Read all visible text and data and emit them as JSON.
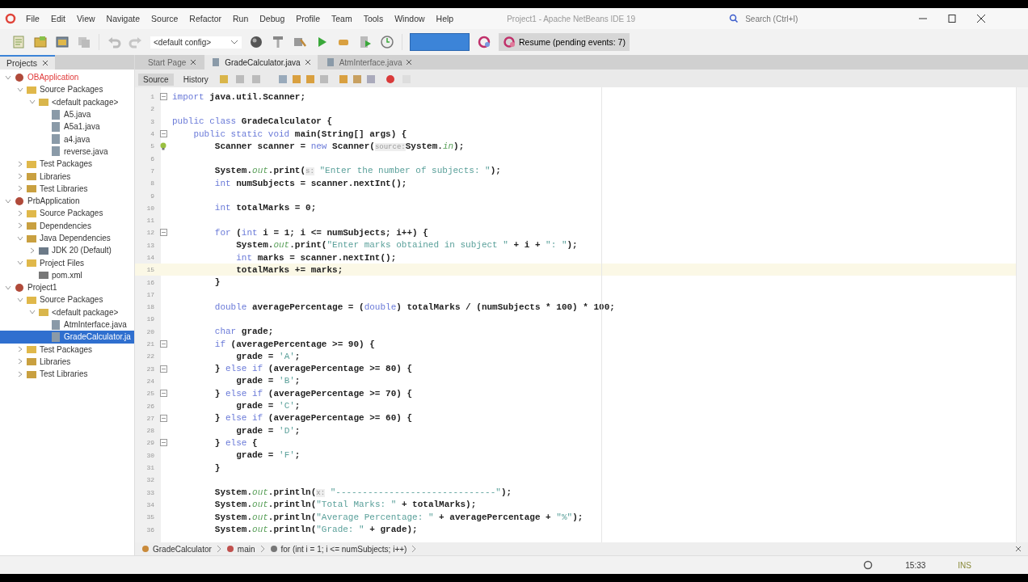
{
  "window": {
    "title": "Project1 - Apache NetBeans IDE 19",
    "search": {
      "placeholder": "Search (Ctrl+I)"
    }
  },
  "menu": [
    "File",
    "Edit",
    "View",
    "Navigate",
    "Source",
    "Refactor",
    "Run",
    "Debug",
    "Profile",
    "Team",
    "Tools",
    "Window",
    "Help"
  ],
  "toolbar": {
    "config": "<default config>",
    "resume": "Resume (pending events: 7)"
  },
  "side_tabs": [
    {
      "label": "Projects",
      "selected": true
    }
  ],
  "tree": [
    {
      "label": "OBApplication",
      "kind": "project",
      "error": true,
      "expanded": true,
      "selected": false,
      "children": [
        {
          "label": "Source Packages",
          "kind": "folder",
          "expanded": true,
          "selected": false,
          "children": [
            {
              "label": "<default package>",
              "kind": "package",
              "expanded": true,
              "selected": false,
              "children": [
                {
                  "label": "A5.java",
                  "kind": "java",
                  "selected": false
                },
                {
                  "label": "A5a1.java",
                  "kind": "java",
                  "selected": false
                },
                {
                  "label": "a4.java",
                  "kind": "java",
                  "selected": false
                },
                {
                  "label": "reverse.java",
                  "kind": "java",
                  "selected": false
                }
              ]
            }
          ]
        },
        {
          "label": "Test Packages",
          "kind": "folder",
          "expanded": false,
          "selected": false
        },
        {
          "label": "Libraries",
          "kind": "library",
          "expanded": false,
          "selected": false
        },
        {
          "label": "Test Libraries",
          "kind": "library",
          "expanded": false,
          "selected": false
        }
      ]
    },
    {
      "label": "PrbApplication",
      "kind": "project",
      "error": false,
      "expanded": true,
      "selected": false,
      "children": [
        {
          "label": "Source Packages",
          "kind": "folder",
          "expanded": false,
          "selected": false
        },
        {
          "label": "Dependencies",
          "kind": "library",
          "expanded": false,
          "selected": false
        },
        {
          "label": "Java Dependencies",
          "kind": "library",
          "expanded": true,
          "selected": false,
          "children": [
            {
              "label": "JDK 20 (Default)",
              "kind": "jdk",
              "expanded": false,
              "selected": false
            }
          ]
        },
        {
          "label": "Project Files",
          "kind": "folder",
          "expanded": true,
          "selected": false,
          "children": [
            {
              "label": "pom.xml",
              "kind": "xml",
              "selected": false
            }
          ]
        }
      ]
    },
    {
      "label": "Project1",
      "kind": "project",
      "error": false,
      "expanded": true,
      "selected": false,
      "children": [
        {
          "label": "Source Packages",
          "kind": "folder",
          "expanded": true,
          "selected": false,
          "children": [
            {
              "label": "<default package>",
              "kind": "package",
              "expanded": true,
              "selected": false,
              "children": [
                {
                  "label": "AtmInterface.java",
                  "kind": "java",
                  "selected": false
                },
                {
                  "label": "GradeCalculator.ja",
                  "kind": "java",
                  "selected": true
                }
              ]
            }
          ]
        },
        {
          "label": "Test Packages",
          "kind": "folder",
          "expanded": false,
          "selected": false
        },
        {
          "label": "Libraries",
          "kind": "library",
          "expanded": false,
          "selected": false
        },
        {
          "label": "Test Libraries",
          "kind": "library",
          "expanded": false,
          "selected": false
        }
      ]
    }
  ],
  "editor_tabs": [
    {
      "label": "Start Page",
      "selected": false
    },
    {
      "label": "GradeCalculator.java",
      "selected": true
    },
    {
      "label": "AtmInterface.java",
      "selected": false
    }
  ],
  "view_tabs": [
    {
      "label": "Source",
      "selected": true
    },
    {
      "label": "History",
      "selected": false
    }
  ],
  "code": [
    {
      "n": "1",
      "current": false,
      "fold": true,
      "seg": [
        {
          "kind": "kw",
          "text": "import"
        },
        {
          "kind": "txt",
          "text": " java.util.Scanner;"
        }
      ]
    },
    {
      "n": "2",
      "current": false
    },
    {
      "n": "3",
      "current": false,
      "seg": [
        {
          "kind": "kw",
          "text": "public class"
        },
        {
          "kind": "txt",
          "text": " GradeCalculator {"
        }
      ]
    },
    {
      "n": "4",
      "current": false,
      "fold": true,
      "seg": [
        {
          "kind": "kw",
          "text": "    public static void"
        },
        {
          "kind": "txt",
          "text": " main(String[] args) {"
        }
      ]
    },
    {
      "n": "5",
      "current": false,
      "bulb": true,
      "seg": [
        {
          "kind": "txt",
          "text": "        Scanner scanner = "
        },
        {
          "kind": "kw",
          "text": "new"
        },
        {
          "kind": "txt",
          "text": " Scanner("
        },
        {
          "kind": "hint",
          "text": "source:"
        },
        {
          "kind": "txt",
          "text": "System."
        },
        {
          "kind": "field",
          "text": "in"
        },
        {
          "kind": "txt",
          "text": ");"
        }
      ]
    },
    {
      "n": "6",
      "current": false
    },
    {
      "n": "7",
      "current": false,
      "seg": [
        {
          "kind": "txt",
          "text": "        System."
        },
        {
          "kind": "field",
          "text": "out"
        },
        {
          "kind": "txt",
          "text": ".print("
        },
        {
          "kind": "hint",
          "text": "s:"
        },
        {
          "kind": "str",
          "text": " \"Enter the number of subjects: \""
        },
        {
          "kind": "txt",
          "text": ");"
        }
      ]
    },
    {
      "n": "8",
      "current": false,
      "seg": [
        {
          "kind": "kw",
          "text": "        int"
        },
        {
          "kind": "txt",
          "text": " numSubjects = scanner.nextInt();"
        }
      ]
    },
    {
      "n": "9",
      "current": false
    },
    {
      "n": "10",
      "current": false,
      "seg": [
        {
          "kind": "kw",
          "text": "        int"
        },
        {
          "kind": "txt",
          "text": " totalMarks = 0;"
        }
      ]
    },
    {
      "n": "11",
      "current": false
    },
    {
      "n": "12",
      "current": false,
      "fold": true,
      "seg": [
        {
          "kind": "kw",
          "text": "        for"
        },
        {
          "kind": "txt",
          "text": " ("
        },
        {
          "kind": "kw",
          "text": "int"
        },
        {
          "kind": "txt",
          "text": " i = 1; i <= numSubjects; i++) {"
        }
      ]
    },
    {
      "n": "13",
      "current": false,
      "seg": [
        {
          "kind": "txt",
          "text": "            System."
        },
        {
          "kind": "field",
          "text": "out"
        },
        {
          "kind": "txt",
          "text": ".print("
        },
        {
          "kind": "str",
          "text": "\"Enter marks obtained in subject \""
        },
        {
          "kind": "txt",
          "text": " + i + "
        },
        {
          "kind": "str",
          "text": "\": \""
        },
        {
          "kind": "txt",
          "text": ");"
        }
      ]
    },
    {
      "n": "14",
      "current": false,
      "seg": [
        {
          "kind": "kw",
          "text": "            int"
        },
        {
          "kind": "txt",
          "text": " marks = scanner.nextInt();"
        }
      ]
    },
    {
      "n": "15",
      "current": true,
      "seg": [
        {
          "kind": "txt",
          "text": "            totalMarks += marks;"
        }
      ]
    },
    {
      "n": "16",
      "current": false,
      "seg": [
        {
          "kind": "txt",
          "text": "        }"
        }
      ]
    },
    {
      "n": "17",
      "current": false
    },
    {
      "n": "18",
      "current": false,
      "seg": [
        {
          "kind": "kw",
          "text": "        double"
        },
        {
          "kind": "txt",
          "text": " averagePercentage = ("
        },
        {
          "kind": "kw",
          "text": "double"
        },
        {
          "kind": "txt",
          "text": ") totalMarks / (numSubjects * 100) * 100;"
        }
      ]
    },
    {
      "n": "19",
      "current": false
    },
    {
      "n": "20",
      "current": false,
      "seg": [
        {
          "kind": "kw",
          "text": "        char"
        },
        {
          "kind": "txt",
          "text": " grade;"
        }
      ]
    },
    {
      "n": "21",
      "current": false,
      "fold": true,
      "seg": [
        {
          "kind": "kw",
          "text": "        if"
        },
        {
          "kind": "txt",
          "text": " (averagePercentage >= 90) {"
        }
      ]
    },
    {
      "n": "22",
      "current": false,
      "seg": [
        {
          "kind": "txt",
          "text": "            grade = "
        },
        {
          "kind": "str",
          "text": "'A'"
        },
        {
          "kind": "txt",
          "text": ";"
        }
      ]
    },
    {
      "n": "23",
      "current": false,
      "fold": true,
      "seg": [
        {
          "kind": "txt",
          "text": "        } "
        },
        {
          "kind": "kw",
          "text": "else if"
        },
        {
          "kind": "txt",
          "text": " (averagePercentage >= 80) {"
        }
      ]
    },
    {
      "n": "24",
      "current": false,
      "seg": [
        {
          "kind": "txt",
          "text": "            grade = "
        },
        {
          "kind": "str",
          "text": "'B'"
        },
        {
          "kind": "txt",
          "text": ";"
        }
      ]
    },
    {
      "n": "25",
      "current": false,
      "fold": true,
      "seg": [
        {
          "kind": "txt",
          "text": "        } "
        },
        {
          "kind": "kw",
          "text": "else if"
        },
        {
          "kind": "txt",
          "text": " (averagePercentage >= 70) {"
        }
      ]
    },
    {
      "n": "26",
      "current": false,
      "seg": [
        {
          "kind": "txt",
          "text": "            grade = "
        },
        {
          "kind": "str",
          "text": "'C'"
        },
        {
          "kind": "txt",
          "text": ";"
        }
      ]
    },
    {
      "n": "27",
      "current": false,
      "fold": true,
      "seg": [
        {
          "kind": "txt",
          "text": "        } "
        },
        {
          "kind": "kw",
          "text": "else if"
        },
        {
          "kind": "txt",
          "text": " (averagePercentage >= 60) {"
        }
      ]
    },
    {
      "n": "28",
      "current": false,
      "seg": [
        {
          "kind": "txt",
          "text": "            grade = "
        },
        {
          "kind": "str",
          "text": "'D'"
        },
        {
          "kind": "txt",
          "text": ";"
        }
      ]
    },
    {
      "n": "29",
      "current": false,
      "fold": true,
      "seg": [
        {
          "kind": "txt",
          "text": "        } "
        },
        {
          "kind": "kw",
          "text": "else"
        },
        {
          "kind": "txt",
          "text": " {"
        }
      ]
    },
    {
      "n": "30",
      "current": false,
      "seg": [
        {
          "kind": "txt",
          "text": "            grade = "
        },
        {
          "kind": "str",
          "text": "'F'"
        },
        {
          "kind": "txt",
          "text": ";"
        }
      ]
    },
    {
      "n": "31",
      "current": false,
      "seg": [
        {
          "kind": "txt",
          "text": "        }"
        }
      ]
    },
    {
      "n": "32",
      "current": false
    },
    {
      "n": "33",
      "current": false,
      "seg": [
        {
          "kind": "txt",
          "text": "        System."
        },
        {
          "kind": "field",
          "text": "out"
        },
        {
          "kind": "txt",
          "text": ".println("
        },
        {
          "kind": "hint",
          "text": "x:"
        },
        {
          "kind": "str",
          "text": " \"------------------------------\""
        },
        {
          "kind": "txt",
          "text": ");"
        }
      ]
    },
    {
      "n": "34",
      "current": false,
      "seg": [
        {
          "kind": "txt",
          "text": "        System."
        },
        {
          "kind": "field",
          "text": "out"
        },
        {
          "kind": "txt",
          "text": ".println("
        },
        {
          "kind": "str",
          "text": "\"Total Marks: \""
        },
        {
          "kind": "txt",
          "text": " + totalMarks);"
        }
      ]
    },
    {
      "n": "35",
      "current": false,
      "seg": [
        {
          "kind": "txt",
          "text": "        System."
        },
        {
          "kind": "field",
          "text": "out"
        },
        {
          "kind": "txt",
          "text": ".println("
        },
        {
          "kind": "str",
          "text": "\"Average Percentage: \""
        },
        {
          "kind": "txt",
          "text": " + averagePercentage + "
        },
        {
          "kind": "str",
          "text": "\"%\""
        },
        {
          "kind": "txt",
          "text": ");"
        }
      ]
    },
    {
      "n": "36",
      "current": false,
      "seg": [
        {
          "kind": "txt",
          "text": "        System."
        },
        {
          "kind": "field",
          "text": "out"
        },
        {
          "kind": "txt",
          "text": ".println("
        },
        {
          "kind": "str",
          "text": "\"Grade: \""
        },
        {
          "kind": "txt",
          "text": " + grade);"
        }
      ]
    }
  ],
  "breadcrumb": [
    {
      "label": "GradeCalculator",
      "kind": "class"
    },
    {
      "label": "main",
      "kind": "method"
    },
    {
      "label": "for (int i = 1; i <= numSubjects; i++)",
      "kind": "loop"
    }
  ],
  "status_bar": {
    "position": "15:33",
    "mode": "INS"
  }
}
